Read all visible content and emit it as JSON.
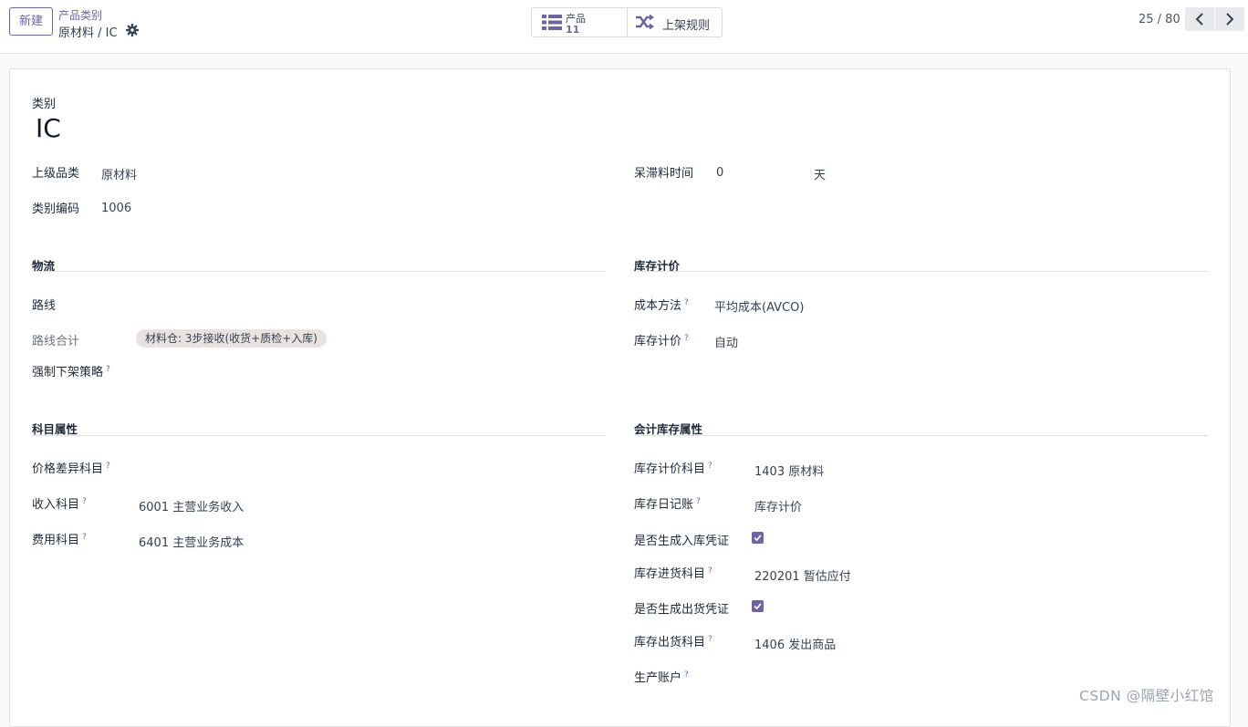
{
  "control_panel": {
    "new_button": "新建",
    "breadcrumb_parent": "产品类别",
    "breadcrumb_current": "原材料 / IC",
    "smart_buttons": [
      {
        "label": "产品",
        "value": "11",
        "icon": "list-icon"
      },
      {
        "label": "上架规则",
        "icon": "shuffle-icon"
      }
    ],
    "pager": "25 / 80"
  },
  "form": {
    "category_label": "类别",
    "category_name": "IC",
    "parent_category": {
      "label": "上级品类",
      "value": "原材料"
    },
    "category_code": {
      "label": "类别编码",
      "value": "1006"
    },
    "dead_stock_time": {
      "label": "呆滞料时间",
      "value": "0",
      "unit": "天"
    },
    "logistics": {
      "title": "物流",
      "routes_label": "路线",
      "routes_total": {
        "label": "路线合计",
        "tag": "材料仓: 3步接收(收货+质检+入库)"
      },
      "removal_strategy": {
        "label": "强制下架策略",
        "help": "?"
      }
    },
    "inventory_valuation": {
      "title": "库存计价",
      "cost_method": {
        "label": "成本方法",
        "help": "?",
        "value": "平均成本(AVCO)"
      },
      "valuation": {
        "label": "库存计价",
        "help": "?",
        "value": "自动"
      }
    },
    "account_properties": {
      "title": "科目属性",
      "price_diff": {
        "label": "价格差异科目",
        "help": "?"
      },
      "income": {
        "label": "收入科目",
        "help": "?",
        "value": "6001 主营业务收入"
      },
      "expense": {
        "label": "费用科目",
        "help": "?",
        "value": "6401 主营业务成本"
      }
    },
    "account_stock_properties": {
      "title": "会计库存属性",
      "valuation_account": {
        "label": "库存计价科目",
        "help": "?",
        "value": "1403 原材料"
      },
      "stock_journal": {
        "label": "库存日记账",
        "help": "?",
        "value": "库存计价"
      },
      "gen_in_voucher": {
        "label": "是否生成入库凭证",
        "checked": true
      },
      "input_account": {
        "label": "库存进货科目",
        "help": "?",
        "value": "220201 暂估应付"
      },
      "gen_out_voucher": {
        "label": "是否生成出货凭证",
        "checked": true
      },
      "output_account": {
        "label": "库存出货科目",
        "help": "?",
        "value": "1406 发出商品"
      },
      "production_account": {
        "label": "生产账户",
        "help": "?"
      }
    }
  },
  "watermark": "CSDN @隔壁小红馆",
  "colors": {
    "accent": "#71639e",
    "tag_bg": "#e8e2e1",
    "border": "#dee2e6"
  }
}
